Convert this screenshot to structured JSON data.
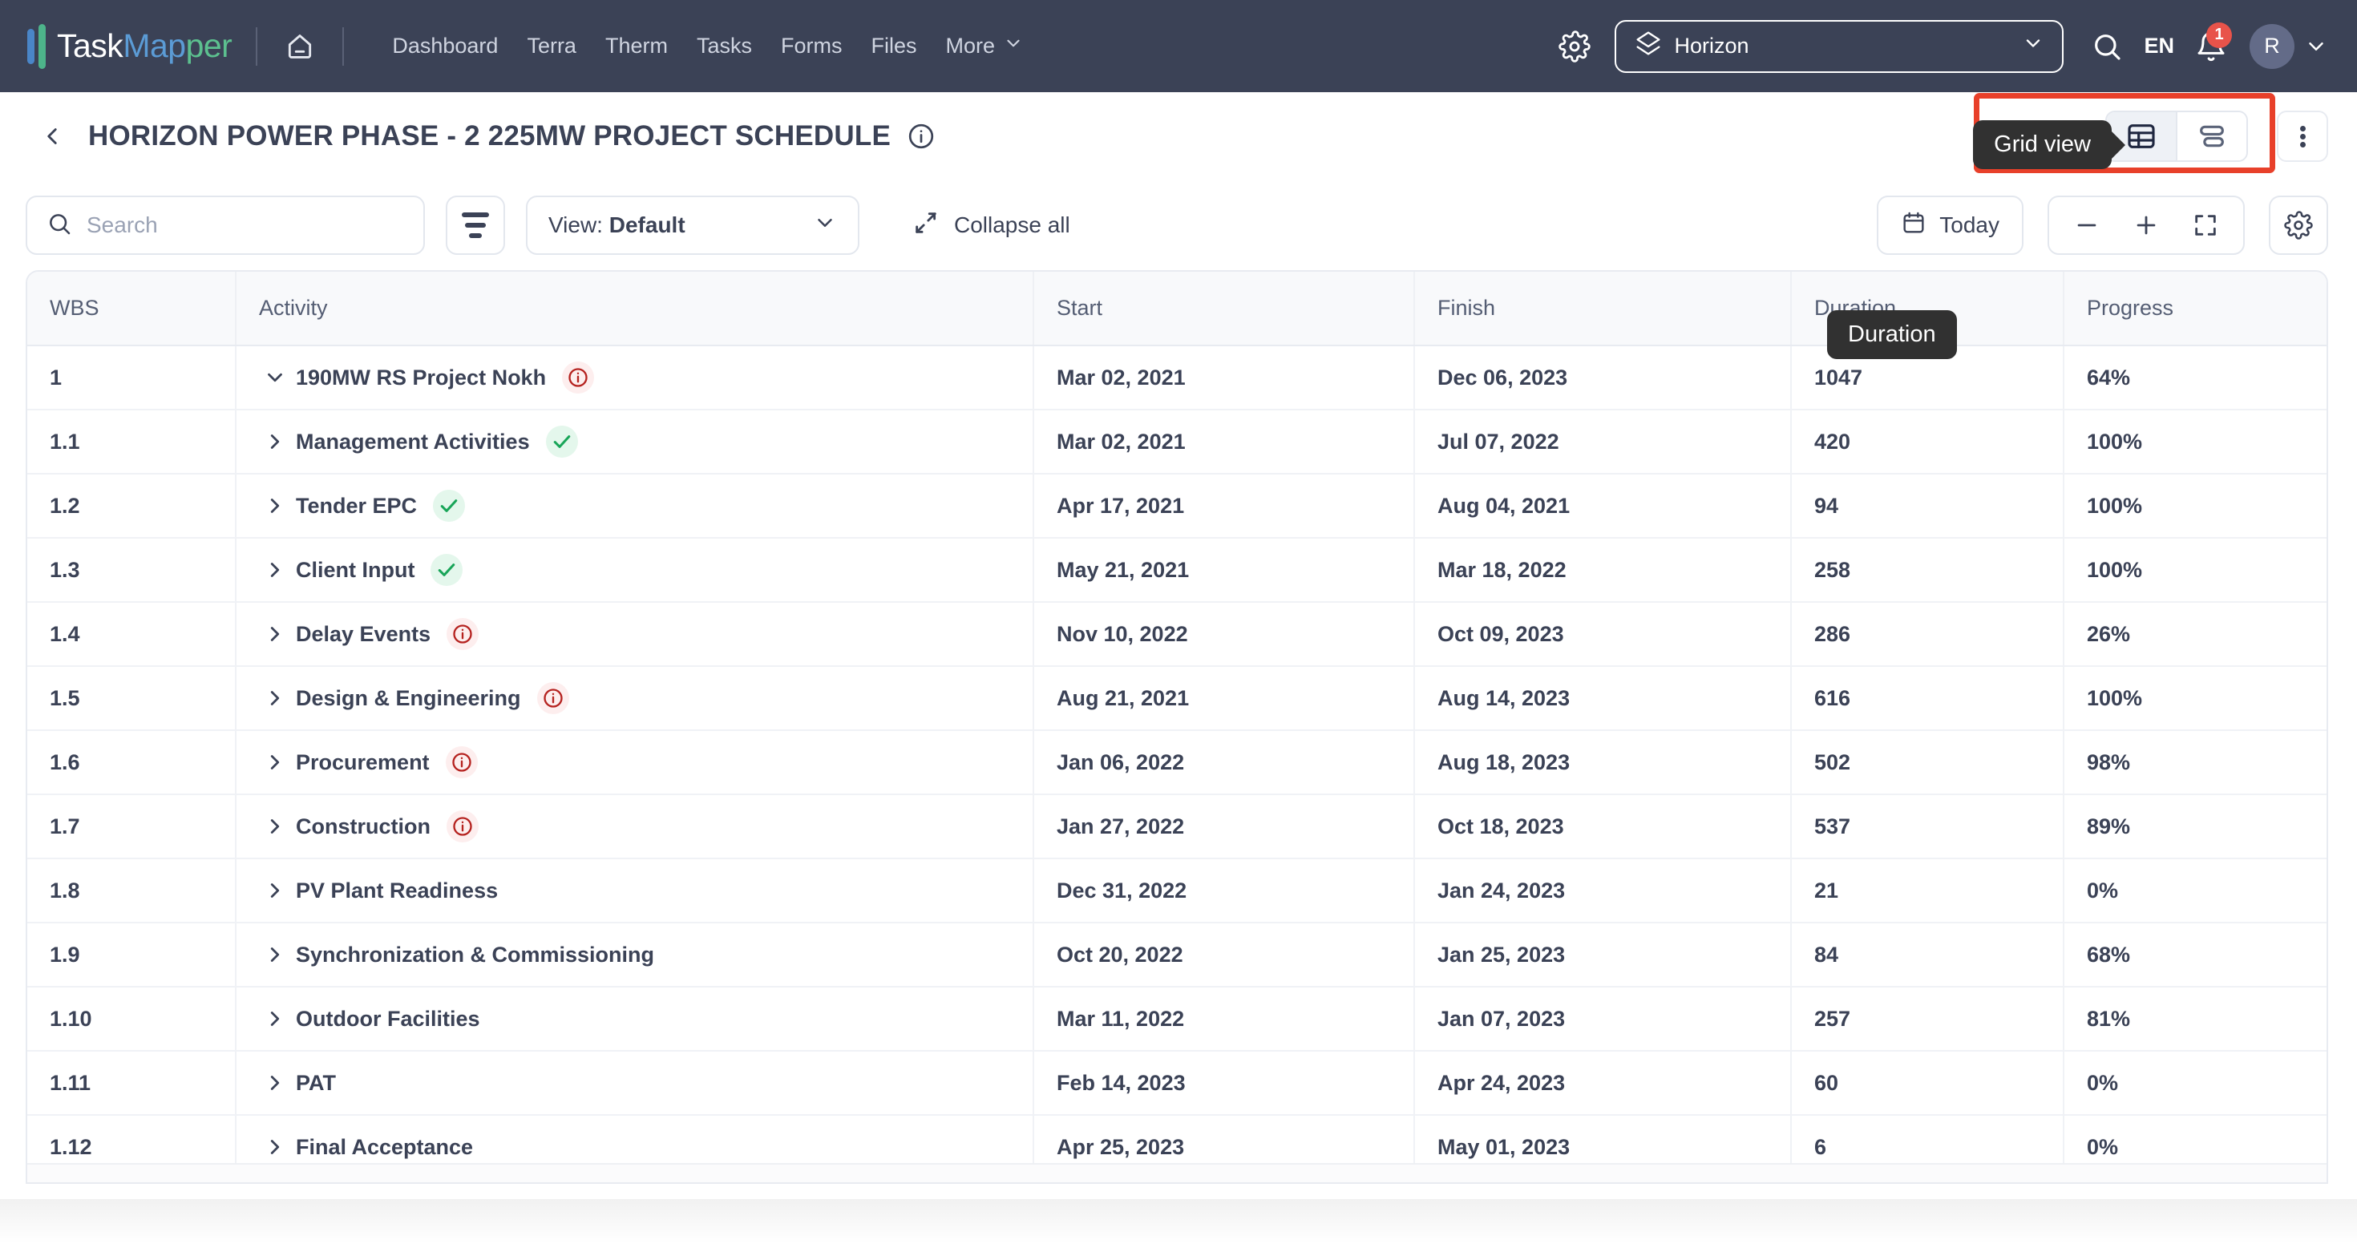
{
  "navbar": {
    "brand": {
      "part1": "Task",
      "part2": "Map",
      "part3": "per"
    },
    "home_icon": "home-icon",
    "links": [
      {
        "label": "Dashboard"
      },
      {
        "label": "Terra"
      },
      {
        "label": "Therm"
      },
      {
        "label": "Tasks"
      },
      {
        "label": "Forms"
      },
      {
        "label": "Files"
      },
      {
        "label": "More",
        "has_caret": true
      }
    ],
    "settings_icon": "gear-icon",
    "project_selector": {
      "value": "Horizon",
      "icon": "layers-icon",
      "caret": "chevron-down-icon"
    },
    "search_icon": "search-icon",
    "language": "EN",
    "notifications": {
      "icon": "bell-icon",
      "count": "1"
    },
    "avatar": {
      "initial": "R",
      "caret": "chevron-down-icon"
    }
  },
  "page_header": {
    "back_icon": "chevron-left-icon",
    "title": "HORIZON POWER PHASE - 2 225MW PROJECT SCHEDULE",
    "info_icon": "info-circle-icon",
    "view_toggle": {
      "grid_icon": "table-grid-icon",
      "grid_active": true,
      "board_icon": "rows-list-icon",
      "tooltip": "Grid view"
    },
    "kebab_icon": "more-vertical-icon"
  },
  "toolbar": {
    "search": {
      "placeholder": "Search",
      "value": "",
      "icon": "search-icon"
    },
    "filter_icon": "filter-icon",
    "view_select": {
      "prefix": "View:",
      "value": "Default",
      "caret": "chevron-down-icon"
    },
    "collapse_all": {
      "label": "Collapse all",
      "icon": "collapse-arrows-icon"
    },
    "today": {
      "label": "Today",
      "icon": "calendar-icon"
    },
    "zoom_out_icon": "minus-icon",
    "zoom_in_icon": "plus-icon",
    "fullscreen_icon": "expand-icon",
    "settings_icon": "gear-icon"
  },
  "table": {
    "columns": [
      "WBS",
      "Activity",
      "Start",
      "Finish",
      "Duration",
      "Progress"
    ],
    "add_column_icon": "plus-icon",
    "duration_tooltip": "Duration",
    "rows": [
      {
        "wbs": "1",
        "activity": "190MW RS Project Nokh",
        "expanded": true,
        "status": "warn",
        "start": "Mar 02, 2021",
        "finish": "Dec 06, 2023",
        "duration": "1047",
        "progress": "64%"
      },
      {
        "wbs": "1.1",
        "activity": "Management Activities",
        "expanded": false,
        "status": "ok",
        "start": "Mar 02, 2021",
        "finish": "Jul 07, 2022",
        "duration": "420",
        "progress": "100%"
      },
      {
        "wbs": "1.2",
        "activity": "Tender EPC",
        "expanded": false,
        "status": "ok",
        "start": "Apr 17, 2021",
        "finish": "Aug 04, 2021",
        "duration": "94",
        "progress": "100%"
      },
      {
        "wbs": "1.3",
        "activity": "Client Input",
        "expanded": false,
        "status": "ok",
        "start": "May 21, 2021",
        "finish": "Mar 18, 2022",
        "duration": "258",
        "progress": "100%"
      },
      {
        "wbs": "1.4",
        "activity": "Delay Events",
        "expanded": false,
        "status": "warn",
        "start": "Nov 10, 2022",
        "finish": "Oct 09, 2023",
        "duration": "286",
        "progress": "26%"
      },
      {
        "wbs": "1.5",
        "activity": "Design & Engineering",
        "expanded": false,
        "status": "warn",
        "start": "Aug 21, 2021",
        "finish": "Aug 14, 2023",
        "duration": "616",
        "progress": "100%"
      },
      {
        "wbs": "1.6",
        "activity": "Procurement",
        "expanded": false,
        "status": "warn",
        "start": "Jan 06, 2022",
        "finish": "Aug 18, 2023",
        "duration": "502",
        "progress": "98%"
      },
      {
        "wbs": "1.7",
        "activity": "Construction",
        "expanded": false,
        "status": "warn",
        "start": "Jan 27, 2022",
        "finish": "Oct 18, 2023",
        "duration": "537",
        "progress": "89%"
      },
      {
        "wbs": "1.8",
        "activity": "PV Plant Readiness",
        "expanded": false,
        "status": "none",
        "start": "Dec 31, 2022",
        "finish": "Jan 24, 2023",
        "duration": "21",
        "progress": "0%"
      },
      {
        "wbs": "1.9",
        "activity": "Synchronization & Commissioning",
        "expanded": false,
        "status": "none",
        "start": "Oct 20, 2022",
        "finish": "Jan 25, 2023",
        "duration": "84",
        "progress": "68%"
      },
      {
        "wbs": "1.10",
        "activity": "Outdoor Facilities",
        "expanded": false,
        "status": "none",
        "start": "Mar 11, 2022",
        "finish": "Jan 07, 2023",
        "duration": "257",
        "progress": "81%"
      },
      {
        "wbs": "1.11",
        "activity": "PAT",
        "expanded": false,
        "status": "none",
        "start": "Feb 14, 2023",
        "finish": "Apr 24, 2023",
        "duration": "60",
        "progress": "0%"
      },
      {
        "wbs": "1.12",
        "activity": "Final Acceptance",
        "expanded": false,
        "status": "none",
        "start": "Apr 25, 2023",
        "finish": "May 01, 2023",
        "duration": "6",
        "progress": "0%"
      }
    ]
  },
  "colors": {
    "navbar_bg": "#3b4256",
    "accent_blue": "#5b9bd5",
    "accent_green": "#5cc08f",
    "badge_red": "#e8534a",
    "highlight_red": "#e8402a",
    "status_warn": "#b5221f",
    "status_ok": "#18a558",
    "text_dark": "#3b4256"
  }
}
